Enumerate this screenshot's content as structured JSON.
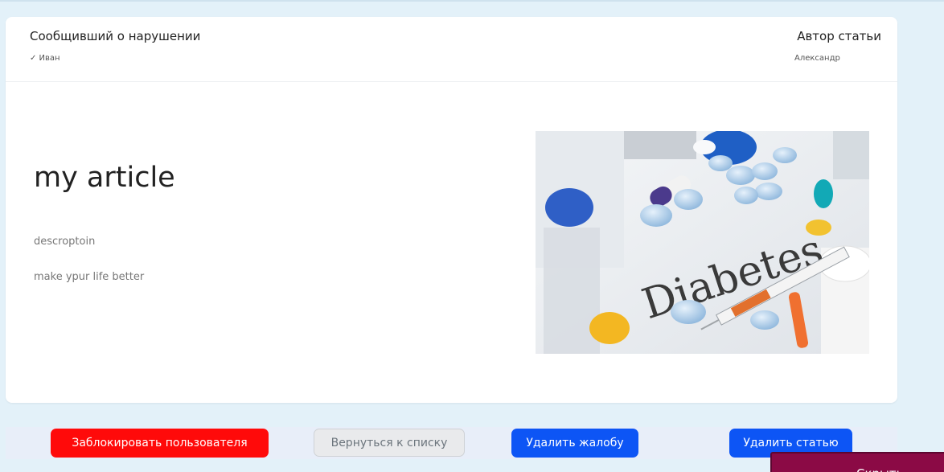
{
  "report": {
    "reporter_title": "Сообщивший о нарушении",
    "reporter_name": "✓ Иван",
    "author_title": "Автор статьи",
    "author_name": "Александр"
  },
  "article": {
    "title": "my article",
    "description": "descroptoin",
    "text": "make ypur life better",
    "image_word": "Diabetes"
  },
  "actions": {
    "block_user": "Заблокировать пользователя",
    "back_to_list": "Вернуться к списку",
    "delete_complaint": "Удалить жалобу",
    "delete_article": "Удалить статью"
  },
  "corner_button": {
    "label": "Скрыть..."
  },
  "colors": {
    "page_bg": "#e3f1f9",
    "danger": "#ff0a0a",
    "primary": "#0d55f5",
    "secondary": "#e9eaec",
    "corner": "#8b0a45"
  }
}
